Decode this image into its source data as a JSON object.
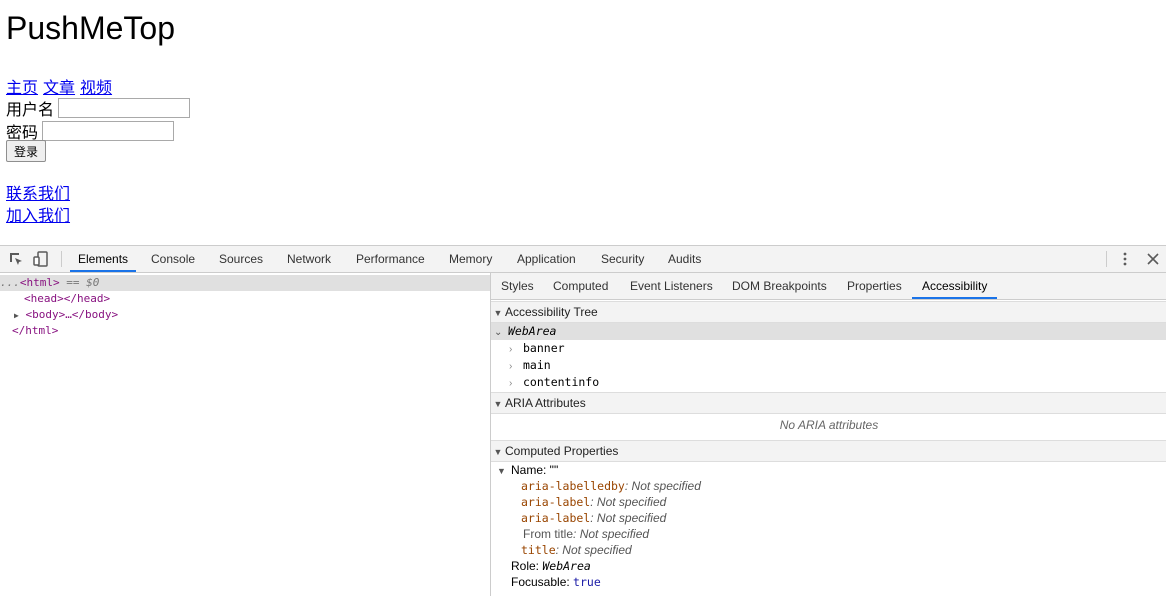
{
  "page": {
    "title": "PushMeTop",
    "nav": [
      "主页",
      "文章",
      "视频"
    ],
    "username_label": "用户名",
    "password_label": "密码",
    "username_value": "",
    "password_value": "",
    "login_button": "登录",
    "footer_links": [
      "联系我们",
      "加入我们"
    ]
  },
  "devtools": {
    "main_tabs": [
      "Elements",
      "Console",
      "Sources",
      "Network",
      "Performance",
      "Memory",
      "Application",
      "Security",
      "Audits"
    ],
    "active_main_tab": "Elements",
    "dom": {
      "html_line_prefix": "...",
      "html_tag": "<html>",
      "html_suffix": " == $0",
      "head_line": "<head></head>",
      "body_line": "<body>…</body>",
      "html_close": "</html>"
    },
    "side_tabs": [
      "Styles",
      "Computed",
      "Event Listeners",
      "DOM Breakpoints",
      "Properties",
      "Accessibility"
    ],
    "active_side_tab": "Accessibility",
    "accessibility": {
      "tree_header": "Accessibility Tree",
      "tree_root": "WebArea",
      "tree_children": [
        "banner",
        "main",
        "contentinfo"
      ],
      "aria_header": "ARIA Attributes",
      "aria_empty": "No ARIA attributes",
      "computed_header": "Computed Properties",
      "name_label": "Name: \"\"",
      "name_sources": [
        {
          "prop": "aria-labelledby",
          "value": "Not specified"
        },
        {
          "prop": "aria-label",
          "value": "Not specified"
        },
        {
          "prop": "aria-label",
          "value": "Not specified"
        },
        {
          "prop": "From title",
          "value": "Not specified"
        },
        {
          "prop": "title",
          "value": "Not specified"
        }
      ],
      "role_label": "Role: ",
      "role_value": "WebArea",
      "focusable_label": "Focusable: ",
      "focusable_value": "true"
    }
  },
  "icons": {
    "inspect": "inspect-element-icon",
    "device": "device-toolbar-icon",
    "menu": "kebab-menu-icon",
    "close": "close-icon"
  }
}
